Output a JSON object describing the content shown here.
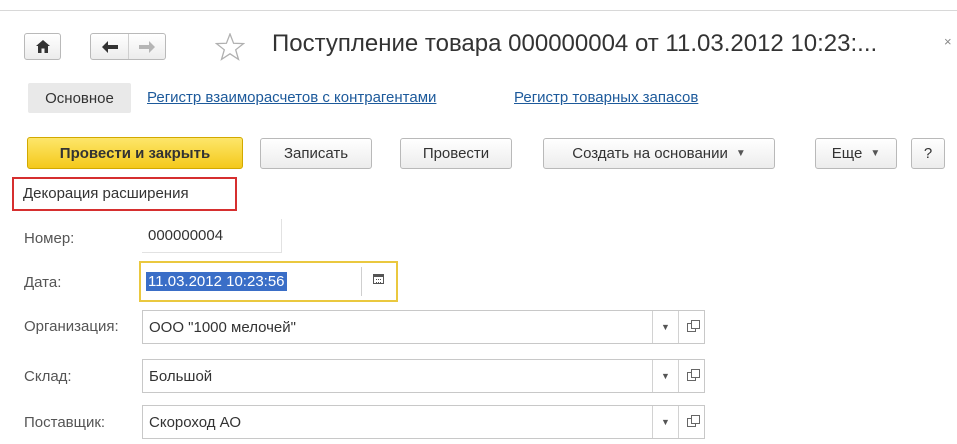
{
  "window": {
    "title": "Поступление товара 000000004 от 11.03.2012 10:23:...",
    "close_icon": "×"
  },
  "nav": {
    "home_icon": "home-icon",
    "back_icon": "arrow-left-icon",
    "forward_icon": "arrow-right-icon",
    "favorite_icon": "star-outline-icon"
  },
  "tabs": [
    {
      "label": "Основное",
      "active": true
    },
    {
      "label": "Регистр взаиморасчетов с контрагентами",
      "active": false
    },
    {
      "label": "Регистр товарных запасов",
      "active": false
    }
  ],
  "toolbar": {
    "post_and_close": "Провести и закрыть",
    "save": "Записать",
    "post": "Провести",
    "create_based_on": "Создать на основании",
    "more": "Еще",
    "help": "?"
  },
  "decoration": {
    "label": "Декорация расширения",
    "border_color": "#d62f2f"
  },
  "form": {
    "number": {
      "label": "Номер:",
      "value": "000000004"
    },
    "date": {
      "label": "Дата:",
      "value": "11.03.2012 10:23:56"
    },
    "organization": {
      "label": "Организация:",
      "value": "ООО \"1000 мелочей\""
    },
    "warehouse": {
      "label": "Склад:",
      "value": "Большой"
    },
    "supplier": {
      "label": "Поставщик:",
      "value": "Скороход АО"
    }
  },
  "colors": {
    "primary_button": "#f4c91b",
    "link": "#1d5a9b",
    "selection": "#3a6ec7",
    "focus_border": "#eac83f"
  }
}
